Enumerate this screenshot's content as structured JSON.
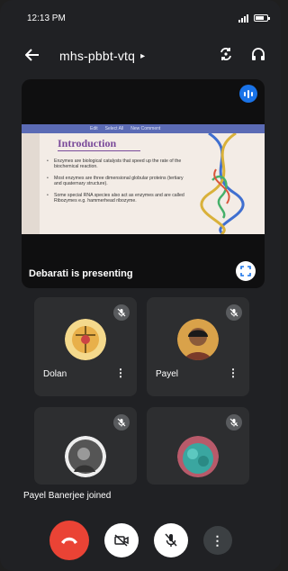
{
  "status_bar": {
    "time": "12:13 PM"
  },
  "header": {
    "meeting_code": "mhs-pbbt-vtq"
  },
  "presentation": {
    "presenter_text": "Debarati is presenting",
    "slide": {
      "toolbar_items": [
        "Edit",
        "Select All",
        "New Comment"
      ],
      "title": "Introduction",
      "bullets": [
        "Enzymes are biological catalysts that speed up the rate of the biochemical reaction.",
        "Most enzymes are three dimensional globular proteins (tertiary and quaternary structure).",
        "Some special RNA species also act as enzymes and are called Ribozymes e.g. hammerhead ribozyme."
      ]
    }
  },
  "participants": [
    {
      "name": "Dolan",
      "avatar_color": "#f4d98c"
    },
    {
      "name": "Payel",
      "avatar_color": "#d9a24a"
    },
    {
      "name": "",
      "avatar_color": "#555555"
    },
    {
      "name": "",
      "avatar_color": "#3aa6a0"
    }
  ],
  "toast": {
    "text": "Payel Banerjee joined"
  },
  "colors": {
    "end_call": "#ea4335",
    "accent": "#1a73e8",
    "background": "#202124",
    "tile": "#2d2e30"
  }
}
